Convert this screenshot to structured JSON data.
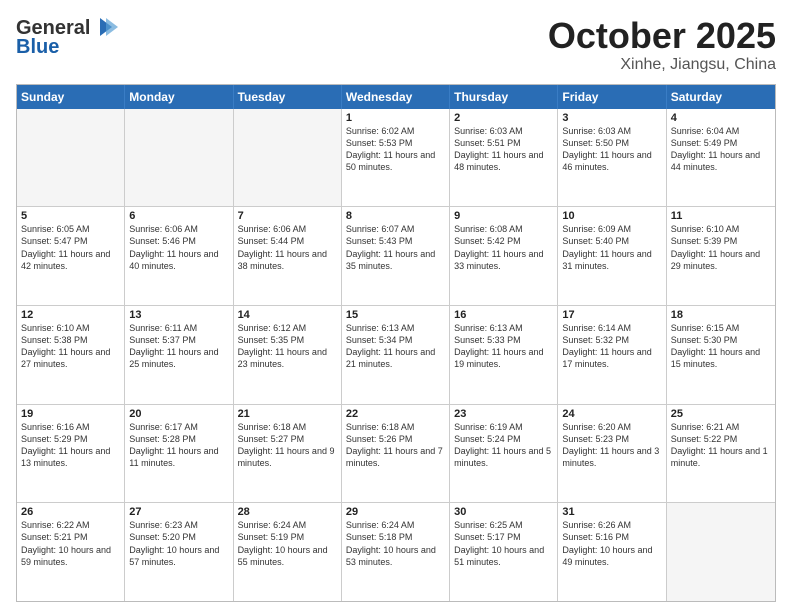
{
  "header": {
    "logo_line1": "General",
    "logo_line2": "Blue",
    "month": "October 2025",
    "location": "Xinhe, Jiangsu, China"
  },
  "weekdays": [
    "Sunday",
    "Monday",
    "Tuesday",
    "Wednesday",
    "Thursday",
    "Friday",
    "Saturday"
  ],
  "rows": [
    [
      {
        "day": "",
        "sunrise": "",
        "sunset": "",
        "daylight": ""
      },
      {
        "day": "",
        "sunrise": "",
        "sunset": "",
        "daylight": ""
      },
      {
        "day": "",
        "sunrise": "",
        "sunset": "",
        "daylight": ""
      },
      {
        "day": "1",
        "sunrise": "Sunrise: 6:02 AM",
        "sunset": "Sunset: 5:53 PM",
        "daylight": "Daylight: 11 hours and 50 minutes."
      },
      {
        "day": "2",
        "sunrise": "Sunrise: 6:03 AM",
        "sunset": "Sunset: 5:51 PM",
        "daylight": "Daylight: 11 hours and 48 minutes."
      },
      {
        "day": "3",
        "sunrise": "Sunrise: 6:03 AM",
        "sunset": "Sunset: 5:50 PM",
        "daylight": "Daylight: 11 hours and 46 minutes."
      },
      {
        "day": "4",
        "sunrise": "Sunrise: 6:04 AM",
        "sunset": "Sunset: 5:49 PM",
        "daylight": "Daylight: 11 hours and 44 minutes."
      }
    ],
    [
      {
        "day": "5",
        "sunrise": "Sunrise: 6:05 AM",
        "sunset": "Sunset: 5:47 PM",
        "daylight": "Daylight: 11 hours and 42 minutes."
      },
      {
        "day": "6",
        "sunrise": "Sunrise: 6:06 AM",
        "sunset": "Sunset: 5:46 PM",
        "daylight": "Daylight: 11 hours and 40 minutes."
      },
      {
        "day": "7",
        "sunrise": "Sunrise: 6:06 AM",
        "sunset": "Sunset: 5:44 PM",
        "daylight": "Daylight: 11 hours and 38 minutes."
      },
      {
        "day": "8",
        "sunrise": "Sunrise: 6:07 AM",
        "sunset": "Sunset: 5:43 PM",
        "daylight": "Daylight: 11 hours and 35 minutes."
      },
      {
        "day": "9",
        "sunrise": "Sunrise: 6:08 AM",
        "sunset": "Sunset: 5:42 PM",
        "daylight": "Daylight: 11 hours and 33 minutes."
      },
      {
        "day": "10",
        "sunrise": "Sunrise: 6:09 AM",
        "sunset": "Sunset: 5:40 PM",
        "daylight": "Daylight: 11 hours and 31 minutes."
      },
      {
        "day": "11",
        "sunrise": "Sunrise: 6:10 AM",
        "sunset": "Sunset: 5:39 PM",
        "daylight": "Daylight: 11 hours and 29 minutes."
      }
    ],
    [
      {
        "day": "12",
        "sunrise": "Sunrise: 6:10 AM",
        "sunset": "Sunset: 5:38 PM",
        "daylight": "Daylight: 11 hours and 27 minutes."
      },
      {
        "day": "13",
        "sunrise": "Sunrise: 6:11 AM",
        "sunset": "Sunset: 5:37 PM",
        "daylight": "Daylight: 11 hours and 25 minutes."
      },
      {
        "day": "14",
        "sunrise": "Sunrise: 6:12 AM",
        "sunset": "Sunset: 5:35 PM",
        "daylight": "Daylight: 11 hours and 23 minutes."
      },
      {
        "day": "15",
        "sunrise": "Sunrise: 6:13 AM",
        "sunset": "Sunset: 5:34 PM",
        "daylight": "Daylight: 11 hours and 21 minutes."
      },
      {
        "day": "16",
        "sunrise": "Sunrise: 6:13 AM",
        "sunset": "Sunset: 5:33 PM",
        "daylight": "Daylight: 11 hours and 19 minutes."
      },
      {
        "day": "17",
        "sunrise": "Sunrise: 6:14 AM",
        "sunset": "Sunset: 5:32 PM",
        "daylight": "Daylight: 11 hours and 17 minutes."
      },
      {
        "day": "18",
        "sunrise": "Sunrise: 6:15 AM",
        "sunset": "Sunset: 5:30 PM",
        "daylight": "Daylight: 11 hours and 15 minutes."
      }
    ],
    [
      {
        "day": "19",
        "sunrise": "Sunrise: 6:16 AM",
        "sunset": "Sunset: 5:29 PM",
        "daylight": "Daylight: 11 hours and 13 minutes."
      },
      {
        "day": "20",
        "sunrise": "Sunrise: 6:17 AM",
        "sunset": "Sunset: 5:28 PM",
        "daylight": "Daylight: 11 hours and 11 minutes."
      },
      {
        "day": "21",
        "sunrise": "Sunrise: 6:18 AM",
        "sunset": "Sunset: 5:27 PM",
        "daylight": "Daylight: 11 hours and 9 minutes."
      },
      {
        "day": "22",
        "sunrise": "Sunrise: 6:18 AM",
        "sunset": "Sunset: 5:26 PM",
        "daylight": "Daylight: 11 hours and 7 minutes."
      },
      {
        "day": "23",
        "sunrise": "Sunrise: 6:19 AM",
        "sunset": "Sunset: 5:24 PM",
        "daylight": "Daylight: 11 hours and 5 minutes."
      },
      {
        "day": "24",
        "sunrise": "Sunrise: 6:20 AM",
        "sunset": "Sunset: 5:23 PM",
        "daylight": "Daylight: 11 hours and 3 minutes."
      },
      {
        "day": "25",
        "sunrise": "Sunrise: 6:21 AM",
        "sunset": "Sunset: 5:22 PM",
        "daylight": "Daylight: 11 hours and 1 minute."
      }
    ],
    [
      {
        "day": "26",
        "sunrise": "Sunrise: 6:22 AM",
        "sunset": "Sunset: 5:21 PM",
        "daylight": "Daylight: 10 hours and 59 minutes."
      },
      {
        "day": "27",
        "sunrise": "Sunrise: 6:23 AM",
        "sunset": "Sunset: 5:20 PM",
        "daylight": "Daylight: 10 hours and 57 minutes."
      },
      {
        "day": "28",
        "sunrise": "Sunrise: 6:24 AM",
        "sunset": "Sunset: 5:19 PM",
        "daylight": "Daylight: 10 hours and 55 minutes."
      },
      {
        "day": "29",
        "sunrise": "Sunrise: 6:24 AM",
        "sunset": "Sunset: 5:18 PM",
        "daylight": "Daylight: 10 hours and 53 minutes."
      },
      {
        "day": "30",
        "sunrise": "Sunrise: 6:25 AM",
        "sunset": "Sunset: 5:17 PM",
        "daylight": "Daylight: 10 hours and 51 minutes."
      },
      {
        "day": "31",
        "sunrise": "Sunrise: 6:26 AM",
        "sunset": "Sunset: 5:16 PM",
        "daylight": "Daylight: 10 hours and 49 minutes."
      },
      {
        "day": "",
        "sunrise": "",
        "sunset": "",
        "daylight": ""
      }
    ]
  ]
}
